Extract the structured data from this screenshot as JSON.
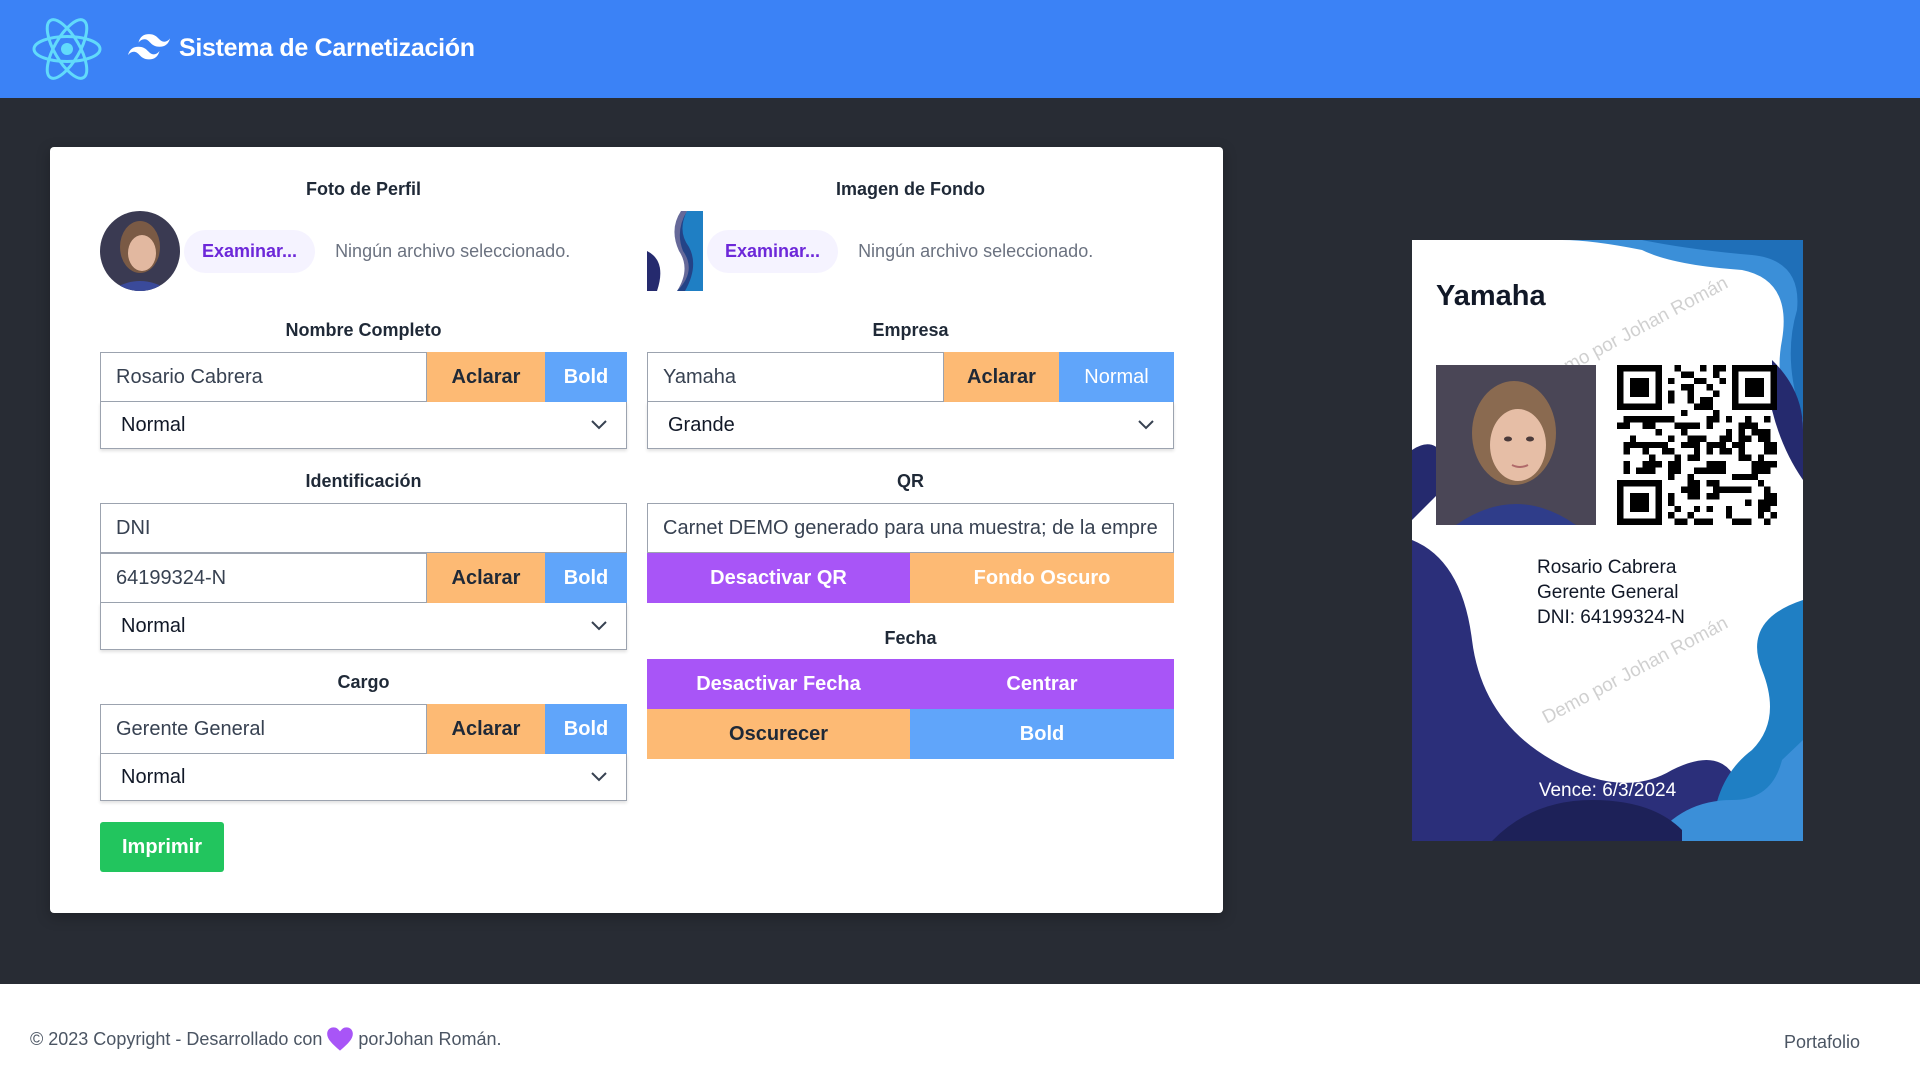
{
  "header": {
    "title": "Sistema de Carnetización",
    "logo_icon": "react-atom-icon",
    "brand_icon": "tailwind-wave-icon",
    "color": "#3b82f6"
  },
  "form": {
    "profile_photo": {
      "title": "Foto de Perfil",
      "button": "Examinar...",
      "status": "Ningún archivo seleccionado."
    },
    "background_image": {
      "title": "Imagen de Fondo",
      "button": "Examinar...",
      "status": "Ningún archivo seleccionado."
    },
    "full_name": {
      "title": "Nombre Completo",
      "value": "Rosario Cabrera",
      "lighten": "Aclarar",
      "weight": "Bold",
      "size": "Normal"
    },
    "company": {
      "title": "Empresa",
      "value": "Yamaha",
      "lighten": "Aclarar",
      "weight": "Normal",
      "size": "Grande"
    },
    "identification": {
      "title": "Identificación",
      "type": "DNI",
      "value": "64199324-N",
      "lighten": "Aclarar",
      "weight": "Bold",
      "size": "Normal"
    },
    "qr": {
      "title": "QR",
      "value": "Carnet DEMO generado para una muestra; de la empres",
      "disable": "Desactivar QR",
      "dark_bg": "Fondo Oscuro"
    },
    "position": {
      "title": "Cargo",
      "value": "Gerente General",
      "lighten": "Aclarar",
      "weight": "Bold",
      "size": "Normal"
    },
    "date": {
      "title": "Fecha",
      "disable": "Desactivar Fecha",
      "center": "Centrar",
      "darken": "Oscurecer",
      "weight": "Bold"
    },
    "print": "Imprimir"
  },
  "card": {
    "company": "Yamaha",
    "name": "Rosario Cabrera",
    "position": "Gerente General",
    "id_line": "DNI: 64199324-N",
    "expiry": "Vence: 6/3/2024",
    "watermark": "Demo por Johan Román"
  },
  "footer": {
    "left_prefix": "© 2023 Copyright - Desarrollado con",
    "left_suffix": "porJohan Román.",
    "right": "Portafolio",
    "heart_icon": "heart-icon"
  },
  "colors": {
    "orange": "#fdba74",
    "blue": "#60a5fa",
    "purple": "#a855f7",
    "green": "#22c55e",
    "dark": "#282c34"
  }
}
